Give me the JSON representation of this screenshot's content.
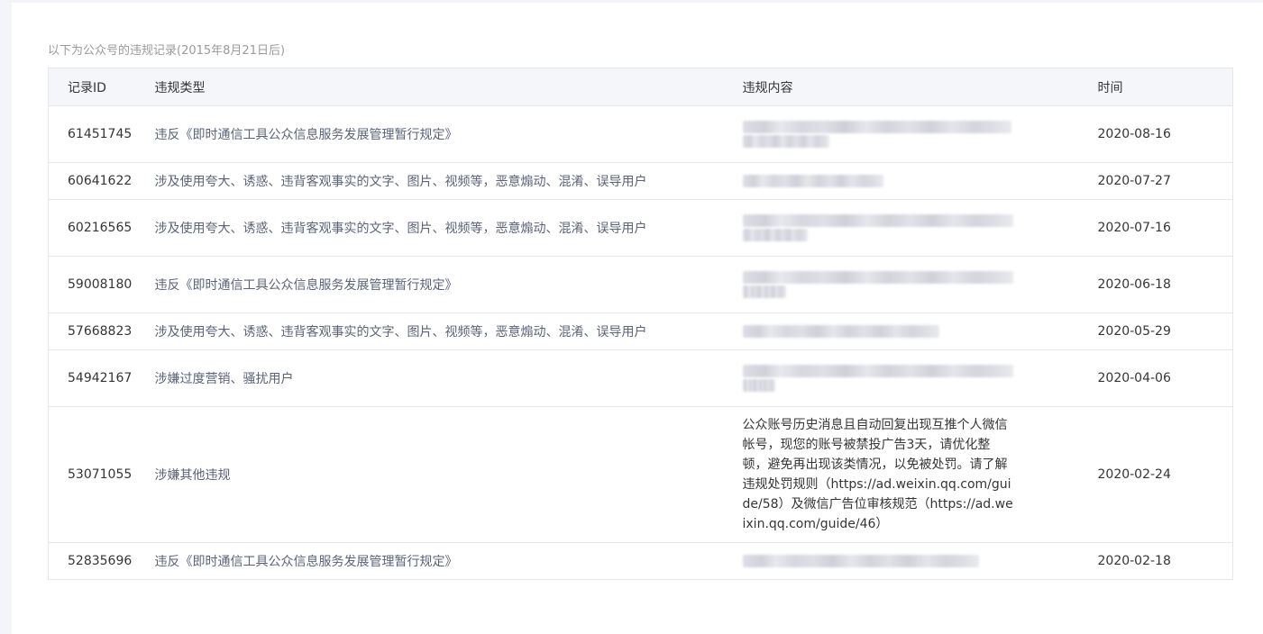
{
  "caption": "以下为公众号的违规记录(2015年8月21日后)",
  "columns": {
    "id": "记录ID",
    "type": "违规类型",
    "content": "违规内容",
    "time": "时间"
  },
  "rows": [
    {
      "id": "61451745",
      "type": "违反《即时通信工具公众信息服务发展管理暂行规定》",
      "content": "",
      "time": "2020-08-16"
    },
    {
      "id": "60641622",
      "type": "涉及使用夸大、诱惑、违背客观事实的文字、图片、视频等，恶意煽动、混淆、误导用户",
      "content": "",
      "time": "2020-07-27"
    },
    {
      "id": "60216565",
      "type": "涉及使用夸大、诱惑、违背客观事实的文字、图片、视频等，恶意煽动、混淆、误导用户",
      "content": "",
      "time": "2020-07-16"
    },
    {
      "id": "59008180",
      "type": "违反《即时通信工具公众信息服务发展管理暂行规定》",
      "content": "",
      "time": "2020-06-18"
    },
    {
      "id": "57668823",
      "type": "涉及使用夸大、诱惑、违背客观事实的文字、图片、视频等，恶意煽动、混淆、误导用户",
      "content": "",
      "time": "2020-05-29"
    },
    {
      "id": "54942167",
      "type": "涉嫌过度营销、骚扰用户",
      "content": "",
      "time": "2020-04-06"
    },
    {
      "id": "53071055",
      "type": "涉嫌其他违规",
      "content": "公众账号历史消息且自动回复出现互推个人微信帐号，现您的账号被禁投广告3天，请优化整顿，避免再出现该类情况，以免被处罚。请了解违规处罚规则（https://ad.weixin.qq.com/guide/58）及微信广告位审核规范（https://ad.weixin.qq.com/guide/46）",
      "time": "2020-02-24"
    },
    {
      "id": "52835696",
      "type": "违反《即时通信工具公众信息服务发展管理暂行规定》",
      "content": "",
      "time": "2020-02-18"
    }
  ]
}
